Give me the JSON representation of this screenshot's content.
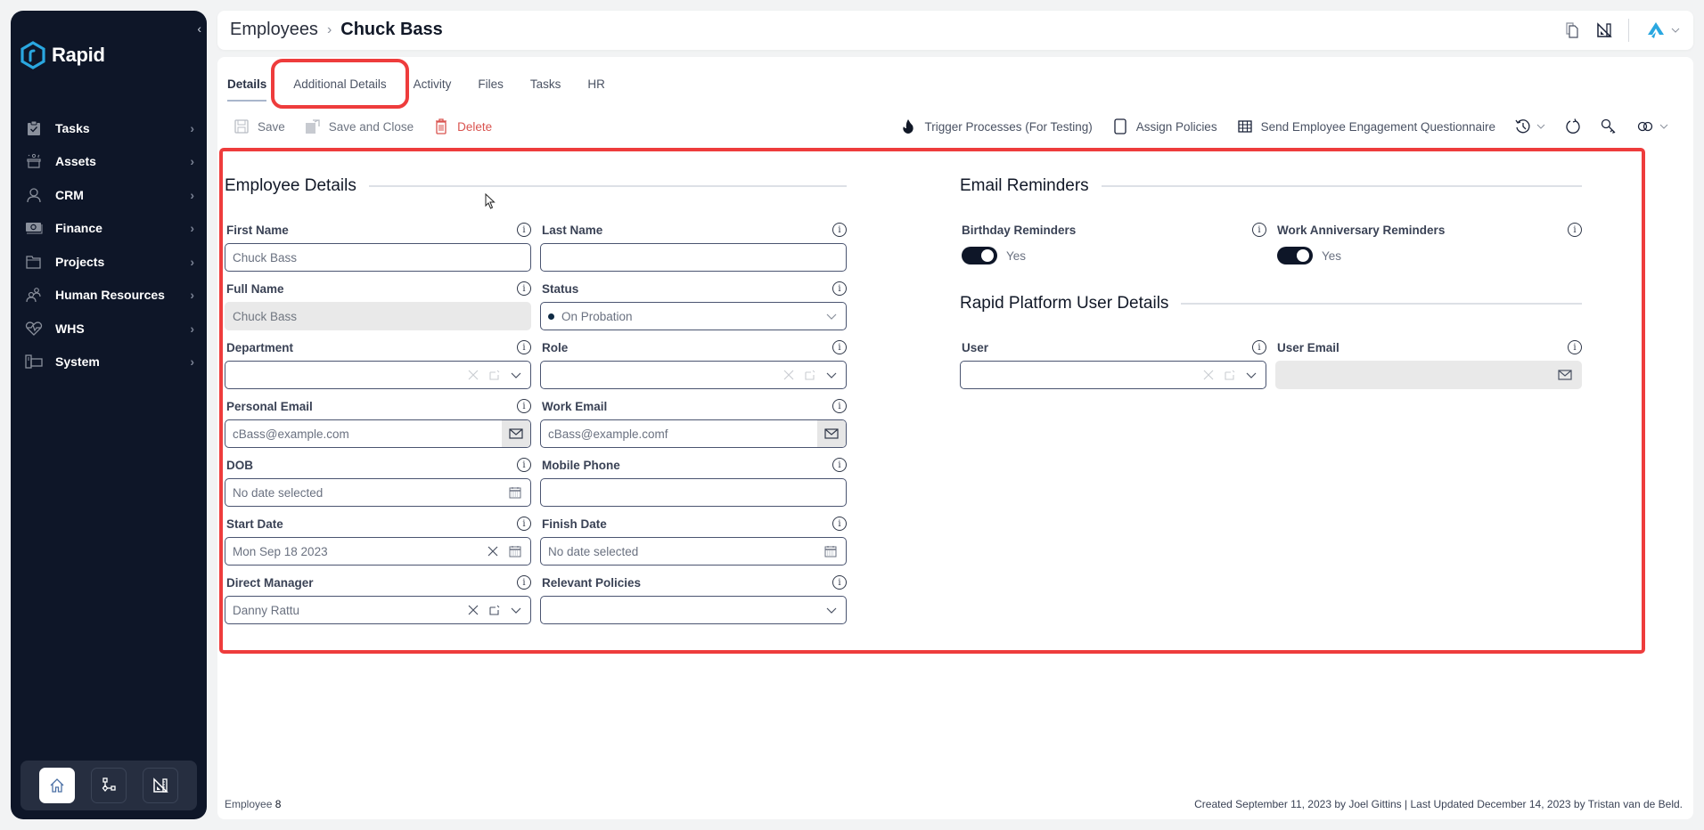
{
  "sidebar": {
    "brand": "Rapid",
    "collapse_icon": "chevron-left-icon",
    "items": [
      {
        "label": "Tasks",
        "icon": "clipboard-check-icon"
      },
      {
        "label": "Assets",
        "icon": "box-sparkle-icon"
      },
      {
        "label": "CRM",
        "icon": "person-icon"
      },
      {
        "label": "Finance",
        "icon": "banknote-icon"
      },
      {
        "label": "Projects",
        "icon": "folder-icon"
      },
      {
        "label": "Human Resources",
        "icon": "people-icon"
      },
      {
        "label": "WHS",
        "icon": "heart-pulse-icon"
      },
      {
        "label": "System",
        "icon": "devices-icon"
      }
    ],
    "dock": [
      {
        "name": "home",
        "icon": "home-icon",
        "active": true
      },
      {
        "name": "workflow",
        "icon": "flow-icon",
        "active": false
      },
      {
        "name": "design",
        "icon": "set-square-icon",
        "active": false
      }
    ]
  },
  "header": {
    "breadcrumb_parent": "Employees",
    "breadcrumb_separator": ">",
    "title": "Chuck Bass"
  },
  "tabs": [
    {
      "label": "Details",
      "active": true
    },
    {
      "label": "Additional Details",
      "active": false,
      "highlighted": true
    },
    {
      "label": "Activity",
      "active": false
    },
    {
      "label": "Files",
      "active": false
    },
    {
      "label": "Tasks",
      "active": false
    },
    {
      "label": "HR",
      "active": false
    }
  ],
  "toolbar": {
    "save_label": "Save",
    "save_close_label": "Save and Close",
    "delete_label": "Delete",
    "trigger_label": "Trigger Processes (For Testing)",
    "assign_policies_label": "Assign Policies",
    "questionnaire_label": "Send Employee Engagement Questionnaire"
  },
  "employee_details": {
    "title": "Employee Details",
    "fields": {
      "first_name": {
        "label": "First Name",
        "value": "Chuck Bass"
      },
      "last_name": {
        "label": "Last Name",
        "value": ""
      },
      "full_name": {
        "label": "Full Name",
        "value": "Chuck Bass"
      },
      "status": {
        "label": "Status",
        "value": "On Probation"
      },
      "department": {
        "label": "Department",
        "value": ""
      },
      "role": {
        "label": "Role",
        "value": ""
      },
      "personal_email": {
        "label": "Personal Email",
        "value": "cBass@example.com"
      },
      "work_email": {
        "label": "Work Email",
        "value": "cBass@example.comf"
      },
      "dob": {
        "label": "DOB",
        "value": "No date selected"
      },
      "mobile_phone": {
        "label": "Mobile Phone",
        "value": ""
      },
      "start_date": {
        "label": "Start Date",
        "value": "Mon Sep 18 2023"
      },
      "finish_date": {
        "label": "Finish Date",
        "value": "No date selected"
      },
      "direct_manager": {
        "label": "Direct Manager",
        "value": "Danny Rattu"
      },
      "relevant_policies": {
        "label": "Relevant Policies",
        "value": ""
      }
    }
  },
  "email_reminders": {
    "title": "Email Reminders",
    "birthday": {
      "label": "Birthday Reminders",
      "value": "Yes",
      "on": true
    },
    "anniversary": {
      "label": "Work Anniversary Reminders",
      "value": "Yes",
      "on": true
    }
  },
  "platform_user": {
    "title": "Rapid Platform User Details",
    "user": {
      "label": "User",
      "value": ""
    },
    "user_email": {
      "label": "User Email",
      "value": ""
    }
  },
  "footer": {
    "record_label": "Employee",
    "record_id": "8",
    "audit": "Created September 11, 2023 by Joel Gittins | Last Updated December 14, 2023 by Tristan van de Beld."
  },
  "colors": {
    "sidebar_bg": "#0e1628",
    "highlight": "#ee3c3c",
    "danger": "#d9534f",
    "brand_blue": "#2aa7e0"
  }
}
